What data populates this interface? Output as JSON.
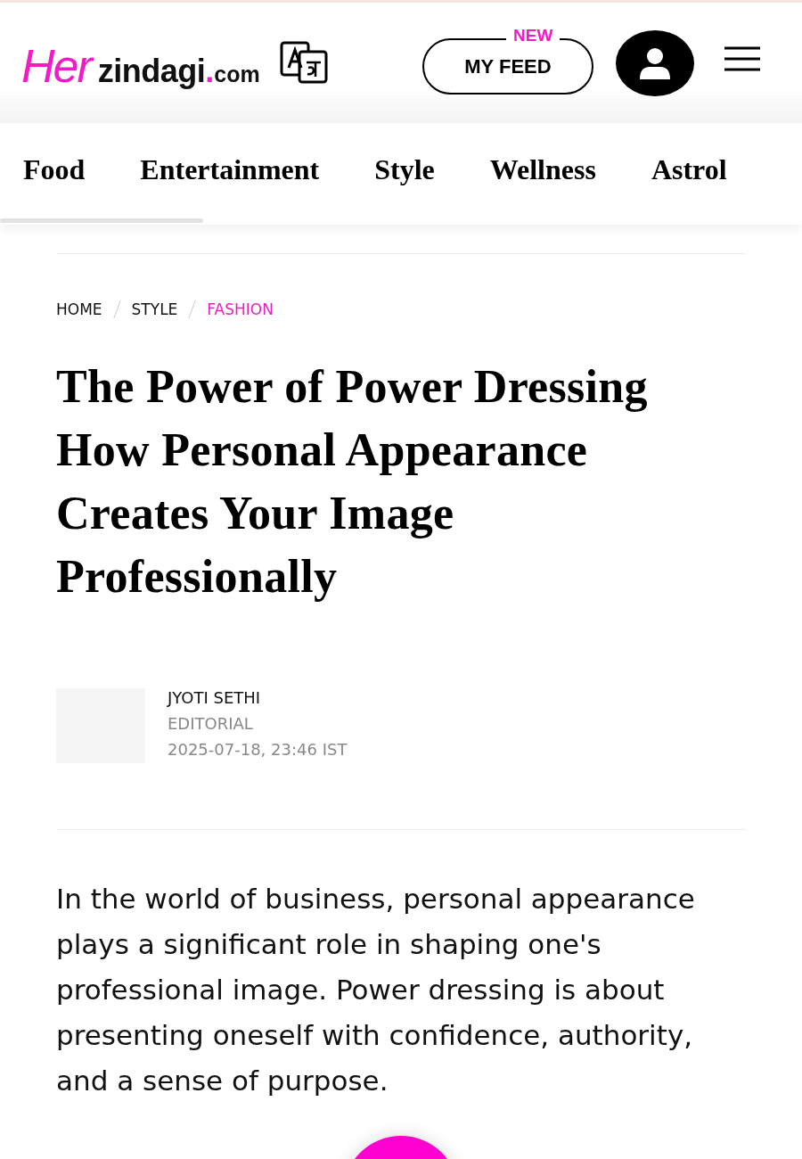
{
  "header": {
    "logo": {
      "brand_part": "Her",
      "name_part": "zindagi",
      "dot": ".",
      "domain": "com"
    },
    "feed_button": {
      "label": "MY FEED",
      "badge": "NEW"
    }
  },
  "nav": {
    "items": [
      {
        "label": "Food"
      },
      {
        "label": "Entertainment"
      },
      {
        "label": "Style"
      },
      {
        "label": "Wellness"
      },
      {
        "label": "Astrol"
      }
    ]
  },
  "breadcrumb": [
    {
      "label": "HOME",
      "current": false
    },
    {
      "label": "STYLE",
      "current": false
    },
    {
      "label": "FASHION",
      "current": true
    }
  ],
  "article": {
    "title": "The Power of Power Dressing How Personal Appearance Creates Your Image Professionally",
    "author": {
      "name": "JYOTI SETHI",
      "role": "EDITORIAL",
      "date": "2025-07-18, 23:46 IST"
    },
    "intro": "In the world of business, personal appearance plays a significant role in shaping one's professional image. Power dressing is about presenting oneself with confidence, authority, and a sense of purpose."
  }
}
